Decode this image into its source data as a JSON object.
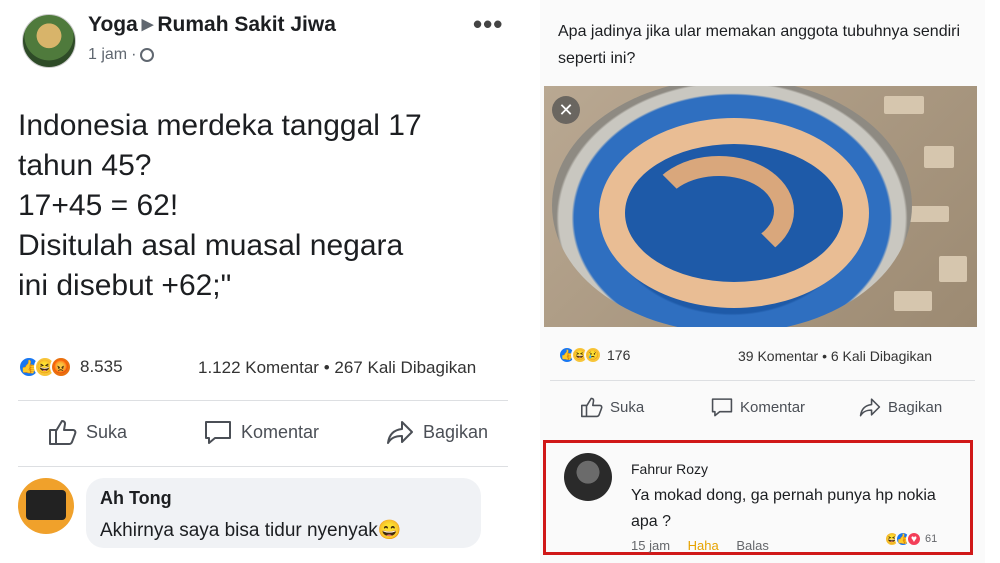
{
  "left_post": {
    "group_user": "Yoga",
    "group_name": "Rumah Sakit Jiwa",
    "time": "1 jam",
    "more_glyph": "•••",
    "text_lines": [
      "Indonesia merdeka tanggal 17",
      "tahun 45?",
      "17+45 = 62!",
      "Disitulah asal muasal negara",
      "ini disebut +62;\""
    ],
    "reaction_count": "8.535",
    "comments": "1.122 Komentar",
    "shares": "267 Kali Dibagikan",
    "actions": {
      "like": "Suka",
      "comment": "Komentar",
      "share": "Bagikan"
    },
    "comment": {
      "author": "Ah Tong",
      "text": "Akhirnya saya bisa tidur nyenyak😄"
    }
  },
  "right_post": {
    "text": "Apa jadinya jika ular memakan anggota tubuhnya sendiri seperti ini?",
    "close_glyph": "✕",
    "reaction_count": "176",
    "comments": "39 Komentar",
    "shares": "6 Kali Dibagikan",
    "actions": {
      "like": "Suka",
      "comment": "Komentar",
      "share": "Bagikan"
    },
    "comment": {
      "author": "Fahrur Rozy",
      "text": "Ya mokad dong, ga pernah punya hp nokia apa ?",
      "time": "15 jam",
      "haha": "Haha",
      "reply": "Balas",
      "reaction_count": "61"
    }
  },
  "colors": {
    "like_blue": "#1877f2",
    "haha_yellow": "#f7c539",
    "angry_orange": "#e9710f",
    "highlight_red": "#d01818"
  },
  "icons": [
    "globe-icon",
    "more-icon",
    "like-icon",
    "comment-icon",
    "share-icon",
    "close-icon"
  ]
}
